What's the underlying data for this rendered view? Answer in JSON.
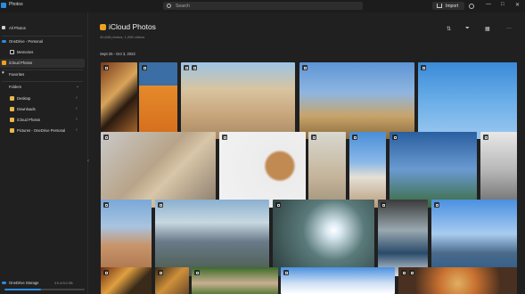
{
  "titlebar": {
    "app_title": "Photos",
    "search_placeholder": "Search",
    "import_label": "Import",
    "minimize": "—",
    "maximize": "□",
    "close": "✕"
  },
  "sidebar": {
    "items": [
      {
        "label": "All Photos",
        "icon": "photos-icon",
        "color": "#cfcfcf"
      },
      {
        "label": "OneDrive - Personal",
        "icon": "onedrive-icon",
        "color": "#2a8ce0"
      },
      {
        "label": "Memories",
        "icon": "memories-icon",
        "color": "#cfcfcf"
      },
      {
        "label": "iCloud Photos",
        "icon": "icloud-icon",
        "color": "#f0a020"
      },
      {
        "label": "Favorites",
        "icon": "heart-icon",
        "color": "#cfcfcf"
      },
      {
        "label": "Folders",
        "icon": "",
        "color": ""
      },
      {
        "label": "Desktop",
        "icon": "folder-icon",
        "color": "#e8b84a"
      },
      {
        "label": "Downloads",
        "icon": "folder-icon",
        "color": "#e8b84a"
      },
      {
        "label": "iCloud Photos",
        "icon": "folder-icon",
        "color": "#e8b84a"
      },
      {
        "label": "Pictures - OneDrive Personal",
        "icon": "folder-icon",
        "color": "#e8b84a"
      }
    ],
    "storage_label": "OneDrive Storage",
    "storage_value": "3.5 of 5.0 GB",
    "storage_fraction": 0.45
  },
  "main": {
    "title": "iCloud Photos",
    "subtitle": "40,608 photos, 1,098 videos",
    "date_range": "Sept 25 - Oct 3, 2022",
    "toolbar_icons": [
      "sort-icon",
      "filter-icon",
      "view-icon",
      "more-icon"
    ]
  },
  "colors": {
    "accent": "#2a8ce0",
    "icloud": "#f0a020",
    "background": "#202020"
  },
  "photos": [
    {
      "name": "photo-food-plates",
      "bg": "linear-gradient(135deg,#7a3a1a,#d9a45a 40%,#2a1a10 60%,#b8702f)"
    },
    {
      "name": "photo-orange-wall",
      "bg": "linear-gradient(180deg,#3a6ea5 0%,#3a6ea5 30%,#e58a2a 30%,#d46c1c 100%)"
    },
    {
      "name": "photo-desert-rocks",
      "bg": "linear-gradient(180deg,#9cc4e6 0%,#d8c4a0 35%,#c7a47a 70%,#a88a64 100%)"
    },
    {
      "name": "photo-joshua-tree",
      "bg": "linear-gradient(180deg,#5d95d6 0%,#8fb6e0 40%,#c8a46a 70%,#8a6a3a 100%)"
    },
    {
      "name": "photo-ride-tower",
      "bg": "linear-gradient(180deg,#3a8ad8 0%,#6aaee8 50%,#9bc8ef 100%)"
    },
    {
      "name": "photo-puppy-chair",
      "bg": "linear-gradient(135deg,#c9c9c9,#b8a488 45%,#d8c6a8 60%,#8a7a6a)"
    },
    {
      "name": "photo-coffee-pastry",
      "bg": "radial-gradient(circle at 70% 45%,#c08a52 0,#c08a52 18%,#ececec 22%,#f2f2f2 100%)"
    },
    {
      "name": "photo-dog-road",
      "bg": "linear-gradient(180deg,#d8d8d0,#c4b49a 60%,#a0927a)"
    },
    {
      "name": "photo-beach-chairs",
      "bg": "linear-gradient(180deg,#4a8ed8 0%,#8ab8e8 40%,#e4e0d4 60%,#b89a7a 100%)"
    },
    {
      "name": "photo-eiffel-tower",
      "bg": "linear-gradient(180deg,#2a5fa0,#6a9ad0 50%,#3a6a3a 100%)"
    },
    {
      "name": "photo-louvre-glass",
      "bg": "linear-gradient(180deg,#e8e8e8,#b8b8b8 50%,#6a6a6a)"
    },
    {
      "name": "photo-desert-walker",
      "bg": "linear-gradient(180deg,#7aa8d8 0%,#a8c4e0 35%,#c8946a 60%,#a8704a 100%)"
    },
    {
      "name": "photo-city-mountains",
      "bg": "linear-gradient(180deg,#8ab0d0 0%,#c8d8e0 30%,#6a7a8a 55%,#4a5a4a 100%)"
    },
    {
      "name": "photo-forest-sun",
      "bg": "radial-gradient(circle at 60% 40%,#ffffff 0,#d8e8f0 10%,#5a7a7a 40%,#2a3a3a 100%)"
    },
    {
      "name": "photo-coast-waves",
      "bg": "linear-gradient(180deg,#3a3a3a,#9aa8b0 40%,#2a4a6a 70%,#d8e0e4)"
    },
    {
      "name": "photo-lake-town",
      "bg": "linear-gradient(180deg,#4a90e0 0%,#a8ccf0 45%,#4a6a8a 70%,#2a5a8a 100%)"
    },
    {
      "name": "photo-food-bowls",
      "bg": "linear-gradient(135deg,#6a2a10,#e0a040 40%,#3a2a1a 70%)"
    },
    {
      "name": "photo-cookies",
      "bg": "linear-gradient(135deg,#3a2a1a,#d0903a 50%,#6a4a2a)"
    },
    {
      "name": "photo-puppy-grass",
      "bg": "linear-gradient(180deg,#3a6a2a,#c8b090 60%,#5a7a3a)"
    },
    {
      "name": "photo-sky-clouds",
      "bg": "linear-gradient(180deg,#4a90e0,#cfe0f4 60%,#ffffff)"
    },
    {
      "name": "photo-salad-plate",
      "bg": "radial-gradient(circle at 50% 60%,#e0b060 0,#c87030 30%,#4a3020 70%)"
    }
  ]
}
